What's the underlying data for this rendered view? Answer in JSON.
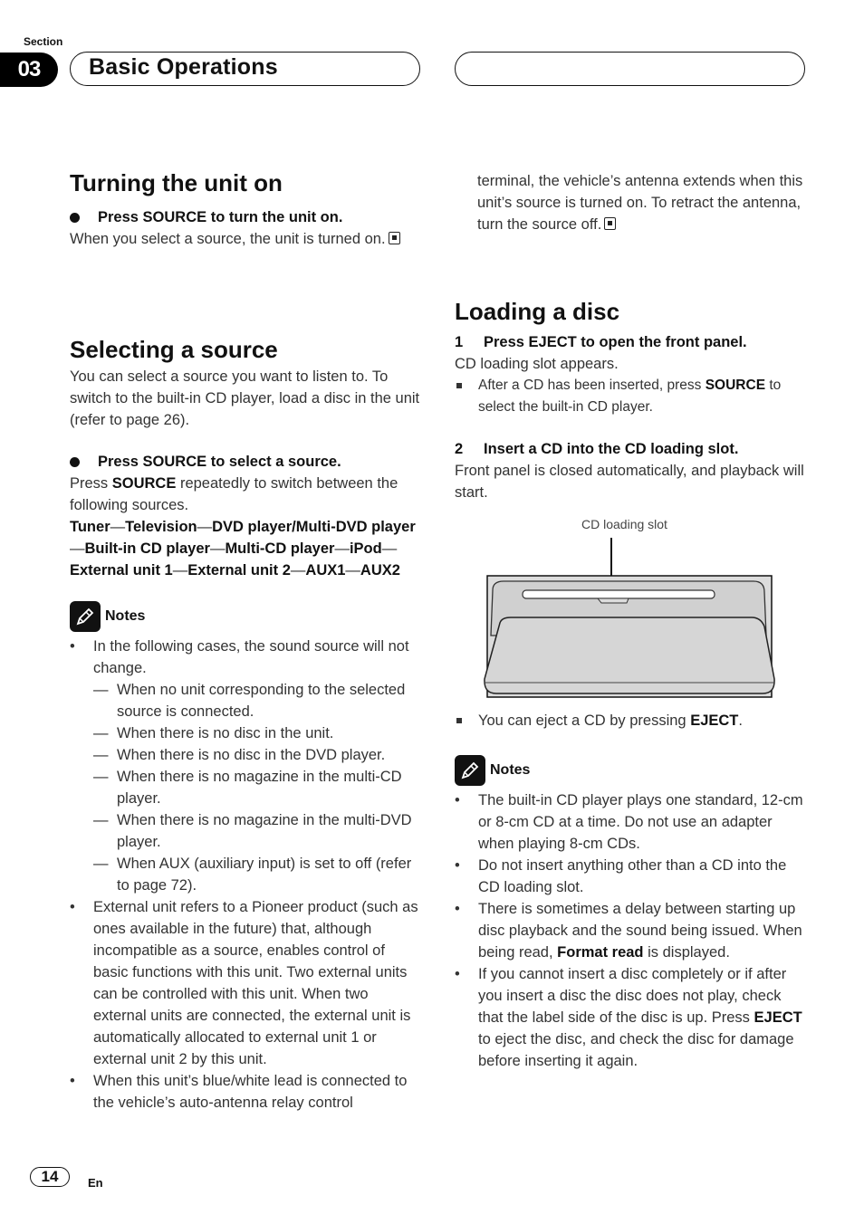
{
  "header": {
    "section_label": "Section",
    "section_number": "03",
    "title": "Basic Operations"
  },
  "turning_on": {
    "heading": "Turning the unit on",
    "step": "Press SOURCE to turn the unit on.",
    "text": "When you select a source, the unit is turned on."
  },
  "selecting_source": {
    "heading": "Selecting a source",
    "intro": "You can select a source you want to listen to. To switch to the built-in CD player, load a disc in the unit (refer to page 26).",
    "step": "Press SOURCE to select a source.",
    "text_pre": "Press ",
    "text_bold": "SOURCE",
    "text_post": " repeatedly to switch between the following sources.",
    "sources": [
      "Tuner",
      "Television",
      "DVD player/Multi-DVD player",
      "Built-in CD player",
      "Multi-CD player",
      "iPod",
      "External unit 1",
      "External unit 2",
      "AUX1",
      "AUX2"
    ],
    "separator": "—"
  },
  "notes_left": {
    "title": "Notes",
    "item1": "In the following cases, the sound source will not change.",
    "sub": [
      "When no unit corresponding to the selected source is connected.",
      "When there is no disc in the unit.",
      "When there is no disc in the DVD player.",
      "When there is no magazine in the multi-CD player.",
      "When there is no magazine in the multi-DVD player.",
      "When AUX (auxiliary input) is set to off (refer to page 72)."
    ],
    "item2": "External unit refers to a Pioneer product (such as ones available in the future) that, although incompatible as a source, enables control of basic functions with this unit. Two external units can be controlled with this unit. When two external units are connected, the external unit is automatically allocated to external unit 1 or external unit 2 by this unit.",
    "item3": "When this unit’s blue/white lead is connected to the vehicle’s auto-antenna relay control terminal, the vehicle’s antenna extends when this unit’s source is turned on. To retract the antenna, turn the source off."
  },
  "loading_disc": {
    "heading": "Loading a disc",
    "step1_num": "1",
    "step1": "Press EJECT to open the front panel.",
    "step1_text": "CD loading slot appears.",
    "step1_note_pre": "After a CD has been inserted, press ",
    "step1_note_bold": "SOURCE",
    "step1_note_post": " to select the built-in CD player.",
    "step2_num": "2",
    "step2": "Insert a CD into the CD loading slot.",
    "step2_text": "Front panel is closed automatically, and playback will start.",
    "figure_caption": "CD loading slot",
    "eject_note_pre": "You can eject a CD by pressing ",
    "eject_note_bold": "EJECT",
    "eject_note_post": "."
  },
  "notes_right": {
    "title": "Notes",
    "item1": "The built-in CD player plays one standard, 12-cm or 8-cm CD at a time. Do not use an adapter when playing 8-cm CDs.",
    "item2": "Do not insert anything other than a CD into the CD loading slot.",
    "item3_pre": "There is sometimes a delay between starting up disc playback and the sound being issued. When being read, ",
    "item3_bold": "Format read",
    "item3_post": " is displayed.",
    "item4_pre": "If you cannot insert a disc completely or if after you insert a disc the disc does not play, check that the label side of the disc is up. Press ",
    "item4_bold": "EJECT",
    "item4_post": " to eject the disc, and check the disc for damage before inserting it again."
  },
  "footer": {
    "page_number": "14",
    "language": "En"
  }
}
